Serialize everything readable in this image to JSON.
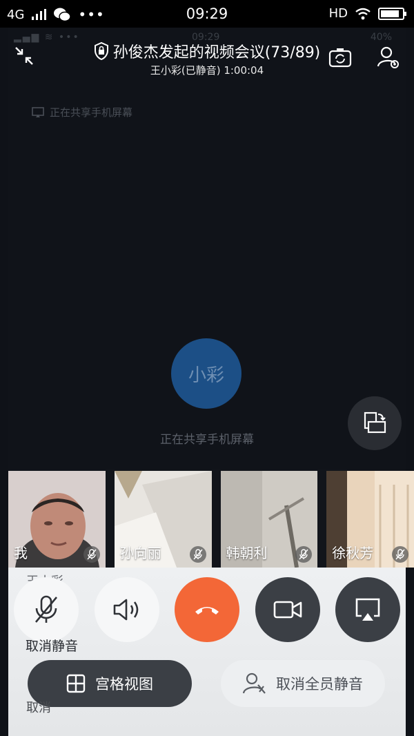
{
  "status_bar": {
    "network": "4G",
    "time": "09:29",
    "hd": "HD"
  },
  "mirrored_status": {
    "time": "09:29",
    "battery": "40%"
  },
  "header": {
    "title": "孙俊杰发起的视频会议(73/89)",
    "subtitle": "王小彩(已静音) 1:00:04"
  },
  "screen": {
    "share_hint_small": "正在共享手机屏幕",
    "avatar_text": "小彩",
    "share_hint": "正在共享手机屏幕"
  },
  "participants": [
    {
      "name": "我",
      "muted": true
    },
    {
      "name": "孙向丽",
      "muted": true
    },
    {
      "name": "韩朝利",
      "muted": true
    },
    {
      "name": "徐秋芳",
      "muted": true
    }
  ],
  "controls": {
    "ghost_name": "王小彩",
    "mute_label": "取消静音",
    "cancel_label": "取消",
    "grid_view_label": "宫格视图",
    "unmute_all_label": "取消全员静音"
  },
  "colors": {
    "hangup": "#f36737",
    "avatar": "#1c4f86"
  }
}
